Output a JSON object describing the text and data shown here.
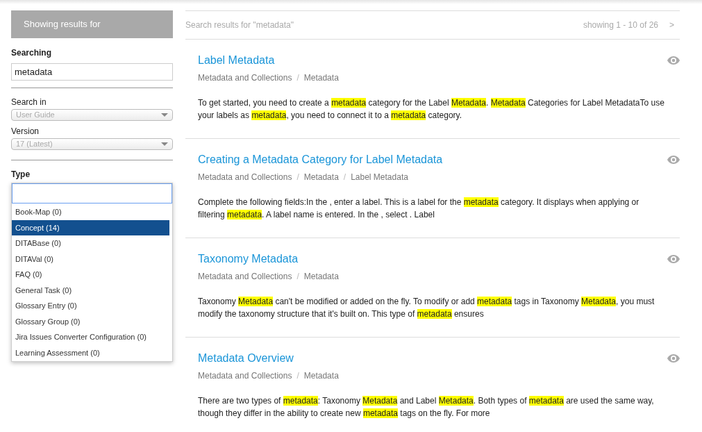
{
  "sidebar": {
    "header": "Showing results for",
    "searching_label": "Searching",
    "search_value": "metadata",
    "search_in_label": "Search in",
    "search_in_value": "User Guide",
    "version_label": "Version",
    "version_value": "17 (Latest)",
    "type_label": "Type",
    "type_options": [
      {
        "label": "Book-Map (0)",
        "selected": false
      },
      {
        "label": "Concept (14)",
        "selected": true
      },
      {
        "label": "DITABase (0)",
        "selected": false
      },
      {
        "label": "DITAVal (0)",
        "selected": false
      },
      {
        "label": "FAQ (0)",
        "selected": false
      },
      {
        "label": "General Task (0)",
        "selected": false
      },
      {
        "label": "Glossary Entry (0)",
        "selected": false
      },
      {
        "label": "Glossary Group (0)",
        "selected": false
      },
      {
        "label": "Jira Issues Converter Configuration (0)",
        "selected": false
      },
      {
        "label": "Learning Assessment (0)",
        "selected": false
      }
    ]
  },
  "results_header": {
    "query": "Search results for  \"metadata\"",
    "paging": "showing 1 - 10 of 26",
    "next": ">"
  },
  "results": [
    {
      "title": "Label Metadata",
      "breadcrumb": [
        "Metadata and Collections",
        "/",
        "Metadata"
      ],
      "snippet": [
        {
          "text": "To get started, you need to create a ",
          "highlight": false
        },
        {
          "text": "metadata",
          "highlight": true
        },
        {
          "text": " category for the Label ",
          "highlight": false
        },
        {
          "text": "Metadata",
          "highlight": true
        },
        {
          "text": ". ",
          "highlight": false
        },
        {
          "text": "Metadata",
          "highlight": true
        },
        {
          "text": " Categories for Label MetadataTo use your labels as ",
          "highlight": false
        },
        {
          "text": "metadata",
          "highlight": true
        },
        {
          "text": ", you need to connect it to a ",
          "highlight": false
        },
        {
          "text": "metadata",
          "highlight": true
        },
        {
          "text": " category.",
          "highlight": false
        }
      ]
    },
    {
      "title": "Creating a Metadata Category for Label Metadata",
      "breadcrumb": [
        "Metadata and Collections",
        "/",
        "Metadata",
        "/",
        "Label Metadata"
      ],
      "snippet": [
        {
          "text": "Complete the following fields:In the , enter a label. This is a label for the ",
          "highlight": false
        },
        {
          "text": "metadata",
          "highlight": true
        },
        {
          "text": " category. It displays when applying or filtering ",
          "highlight": false
        },
        {
          "text": "metadata",
          "highlight": true
        },
        {
          "text": ". A label name is entered. In the , select . Label",
          "highlight": false
        }
      ]
    },
    {
      "title": "Taxonomy Metadata",
      "breadcrumb": [
        "Metadata and Collections",
        "/",
        "Metadata"
      ],
      "snippet": [
        {
          "text": "Taxonomy ",
          "highlight": false
        },
        {
          "text": "Metadata",
          "highlight": true
        },
        {
          "text": " can't be modified or added on the fly. To modify or add ",
          "highlight": false
        },
        {
          "text": "metadata",
          "highlight": true
        },
        {
          "text": " tags in Taxonomy ",
          "highlight": false
        },
        {
          "text": "Metadata",
          "highlight": true
        },
        {
          "text": ", you must modify the taxonomy structure that it's built on. This type of ",
          "highlight": false
        },
        {
          "text": "metadata",
          "highlight": true
        },
        {
          "text": " ensures",
          "highlight": false
        }
      ]
    },
    {
      "title": "Metadata Overview",
      "breadcrumb": [
        "Metadata and Collections",
        "/",
        "Metadata"
      ],
      "snippet": [
        {
          "text": "There are two types of ",
          "highlight": false
        },
        {
          "text": "metadata",
          "highlight": true
        },
        {
          "text": ": Taxonomy ",
          "highlight": false
        },
        {
          "text": "Metadata",
          "highlight": true
        },
        {
          "text": " and Label ",
          "highlight": false
        },
        {
          "text": "Metadata",
          "highlight": true
        },
        {
          "text": ". Both types of ",
          "highlight": false
        },
        {
          "text": "metadata",
          "highlight": true
        },
        {
          "text": " are used the same way, though they differ in the ability to create new ",
          "highlight": false
        },
        {
          "text": "metadata",
          "highlight": true
        },
        {
          "text": " tags on the fly. For more",
          "highlight": false
        }
      ]
    }
  ]
}
